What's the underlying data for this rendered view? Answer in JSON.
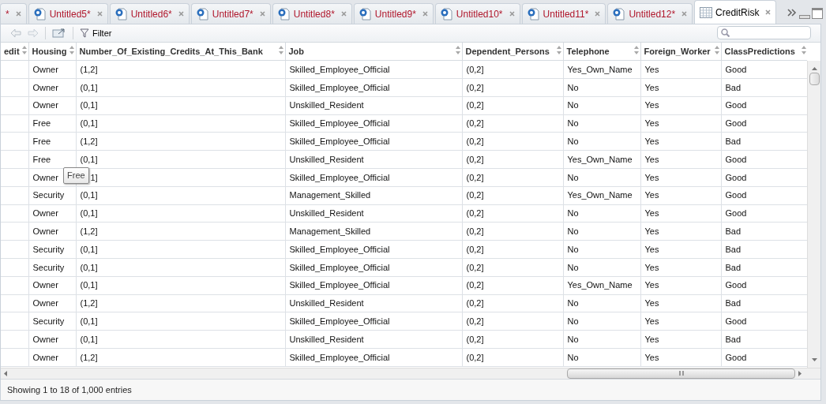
{
  "tabs": [
    {
      "label": "*",
      "kind": "script",
      "selected": false
    },
    {
      "label": "Untitled5*",
      "kind": "script",
      "selected": false
    },
    {
      "label": "Untitled6*",
      "kind": "script",
      "selected": false
    },
    {
      "label": "Untitled7*",
      "kind": "script",
      "selected": false
    },
    {
      "label": "Untitled8*",
      "kind": "script",
      "selected": false
    },
    {
      "label": "Untitled9*",
      "kind": "script",
      "selected": false
    },
    {
      "label": "Untitled10*",
      "kind": "script",
      "selected": false
    },
    {
      "label": "Untitled11*",
      "kind": "script",
      "selected": false
    },
    {
      "label": "Untitled12*",
      "kind": "script",
      "selected": false
    },
    {
      "label": "CreditRisk",
      "kind": "data",
      "selected": true
    }
  ],
  "toolbar": {
    "filter": "Filter"
  },
  "table": {
    "columns": [
      "edit",
      "Housing",
      "Number_Of_Existing_Credits_At_This_Bank",
      "Job",
      "Dependent_Persons",
      "Telephone",
      "Foreign_Worker",
      "ClassPredictions"
    ],
    "rows": [
      [
        "",
        "Owner",
        "(1,2]",
        "Skilled_Employee_Official",
        "(0,2]",
        "Yes_Own_Name",
        "Yes",
        "Good"
      ],
      [
        "",
        "Owner",
        "(0,1]",
        "Skilled_Employee_Official",
        "(0,2]",
        "No",
        "Yes",
        "Bad"
      ],
      [
        "",
        "Owner",
        "(0,1]",
        "Unskilled_Resident",
        "(0,2]",
        "No",
        "Yes",
        "Good"
      ],
      [
        "",
        "Free",
        "(0,1]",
        "Skilled_Employee_Official",
        "(0,2]",
        "No",
        "Yes",
        "Good"
      ],
      [
        "",
        "Free",
        "(1,2]",
        "Skilled_Employee_Official",
        "(0,2]",
        "No",
        "Yes",
        "Bad"
      ],
      [
        "",
        "Free",
        "(0,1]",
        "Unskilled_Resident",
        "(0,2]",
        "Yes_Own_Name",
        "Yes",
        "Good"
      ],
      [
        "",
        "Owner",
        {
          "text": "1]",
          "partly_covered": true
        },
        "Skilled_Employee_Official",
        "(0,2]",
        "No",
        "Yes",
        "Good"
      ],
      [
        "",
        "Security",
        "(0,1]",
        "Management_Skilled",
        "(0,2]",
        "Yes_Own_Name",
        "Yes",
        "Good"
      ],
      [
        "",
        "Owner",
        "(0,1]",
        "Unskilled_Resident",
        "(0,2]",
        "No",
        "Yes",
        "Good"
      ],
      [
        "",
        "Owner",
        "(1,2]",
        "Management_Skilled",
        "(0,2]",
        "No",
        "Yes",
        "Bad"
      ],
      [
        "",
        "Security",
        "(0,1]",
        "Skilled_Employee_Official",
        "(0,2]",
        "No",
        "Yes",
        "Bad"
      ],
      [
        "",
        "Security",
        "(0,1]",
        "Skilled_Employee_Official",
        "(0,2]",
        "No",
        "Yes",
        "Bad"
      ],
      [
        "",
        "Owner",
        "(0,1]",
        "Skilled_Employee_Official",
        "(0,2]",
        "Yes_Own_Name",
        "Yes",
        "Good"
      ],
      [
        "",
        "Owner",
        "(1,2]",
        "Unskilled_Resident",
        "(0,2]",
        "No",
        "Yes",
        "Bad"
      ],
      [
        "",
        "Security",
        "(0,1]",
        "Skilled_Employee_Official",
        "(0,2]",
        "No",
        "Yes",
        "Good"
      ],
      [
        "",
        "Owner",
        "(0,1]",
        "Unskilled_Resident",
        "(0,2]",
        "No",
        "Yes",
        "Bad"
      ],
      [
        "",
        "Owner",
        "(1,2]",
        "Skilled_Employee_Official",
        "(0,2]",
        "No",
        "Yes",
        "Good"
      ]
    ]
  },
  "tooltip": {
    "text": "Free"
  },
  "status_bar": "Showing 1 to 18 of 1,000 entries"
}
